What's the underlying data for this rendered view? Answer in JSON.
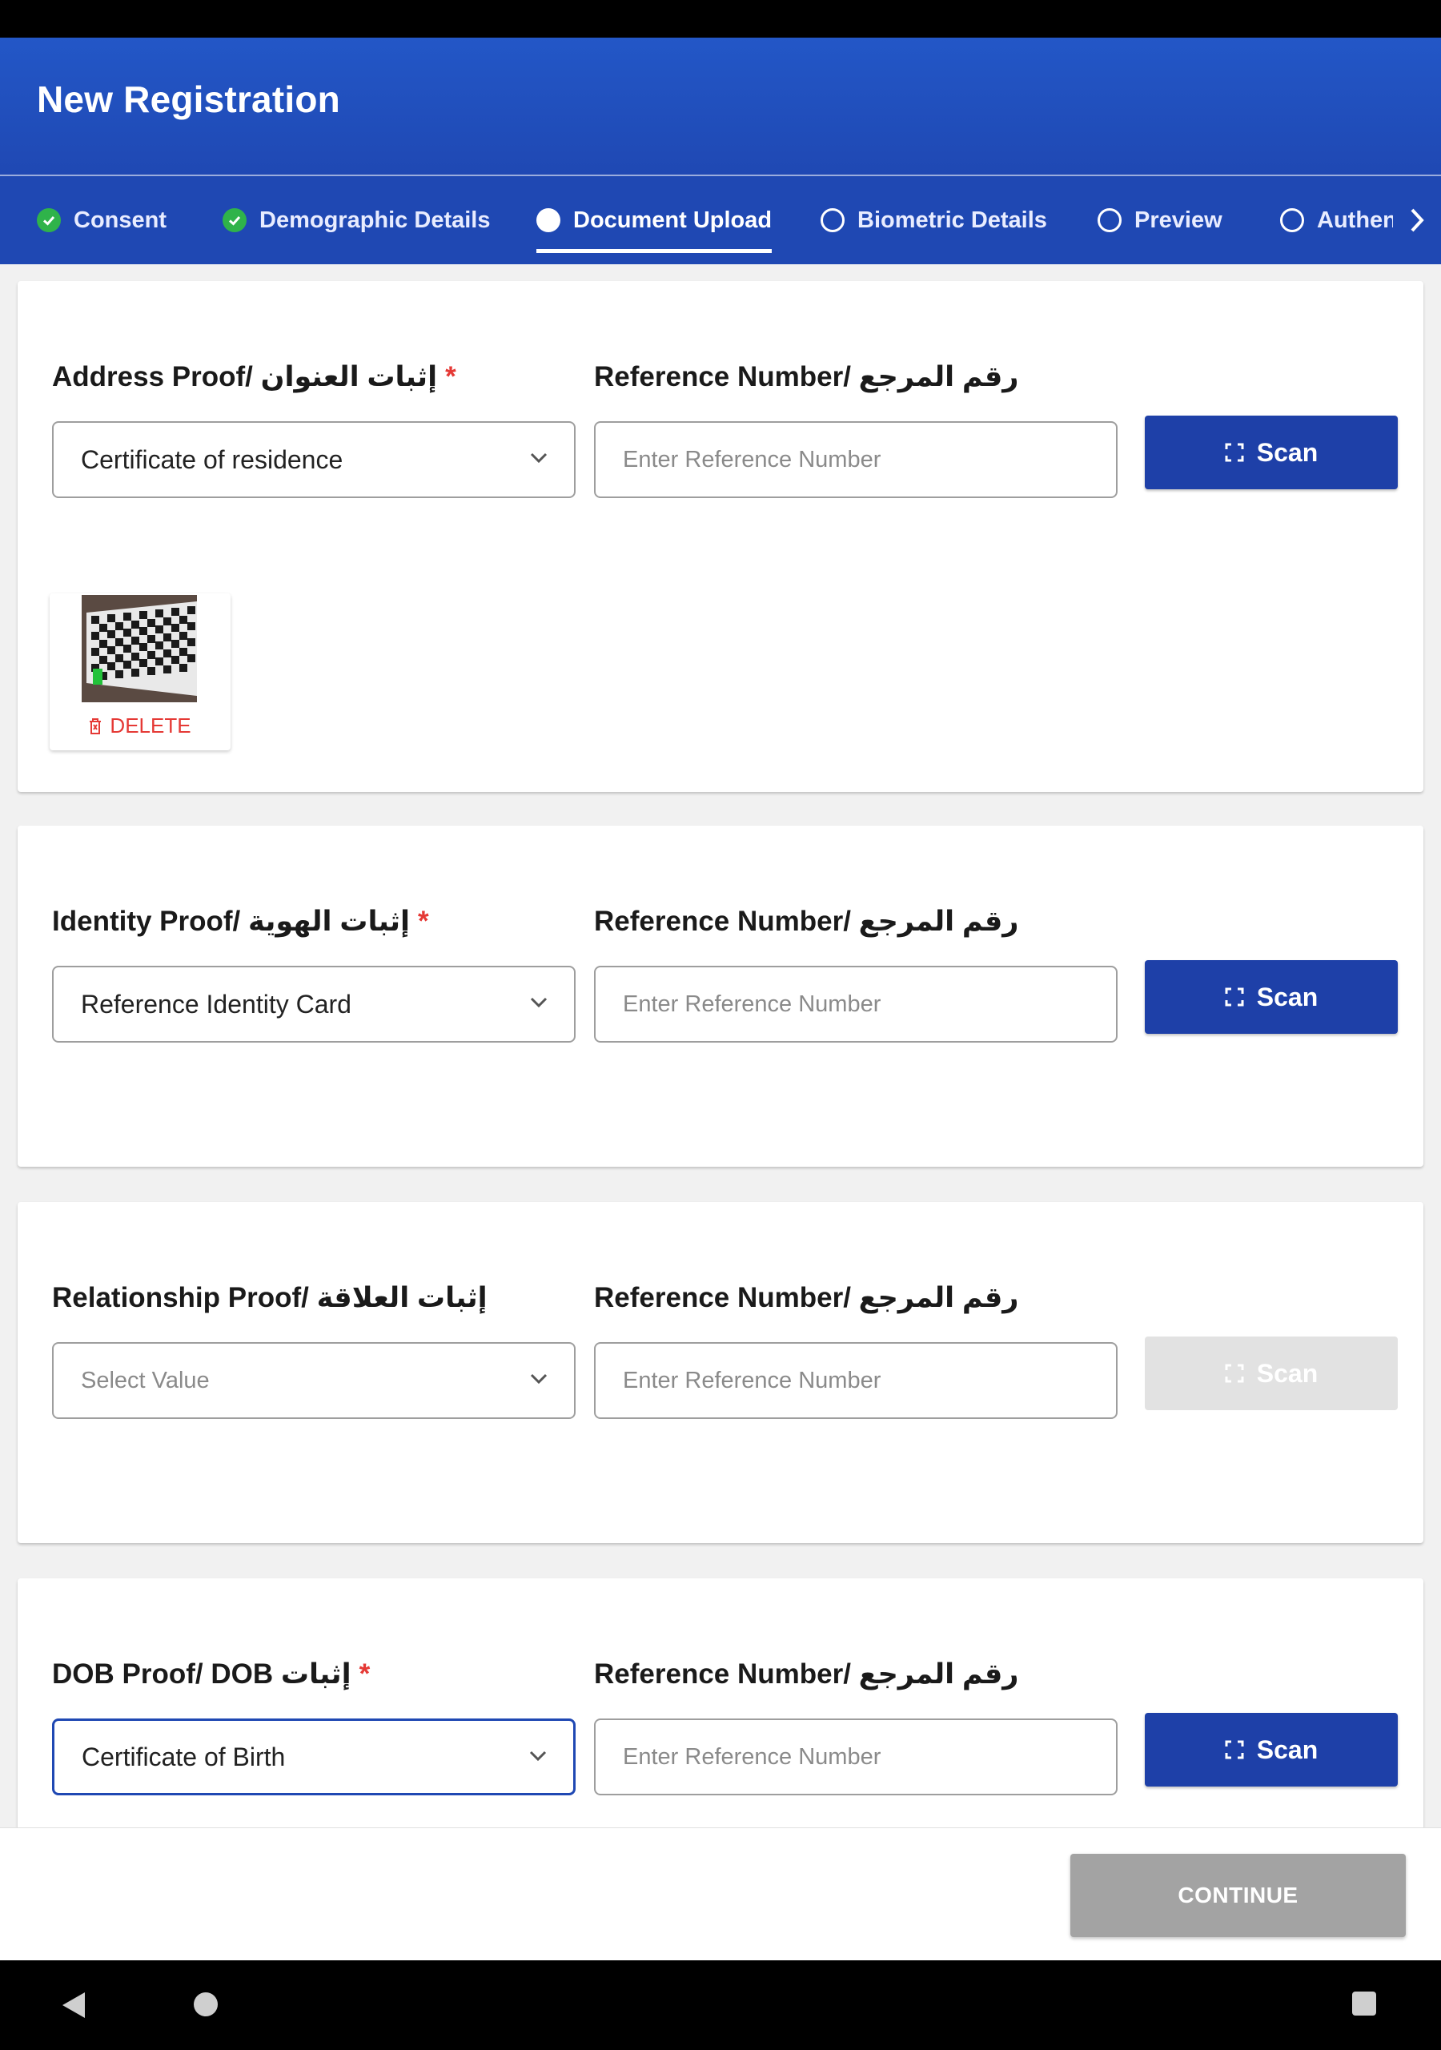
{
  "app": {
    "title": "New Registration"
  },
  "tabs": [
    {
      "label": "Consent",
      "state": "done"
    },
    {
      "label": "Demographic Details",
      "state": "done"
    },
    {
      "label": "Document Upload",
      "state": "active"
    },
    {
      "label": "Biometric Details",
      "state": "pending"
    },
    {
      "label": "Preview",
      "state": "pending"
    },
    {
      "label": "Authent",
      "state": "pending"
    }
  ],
  "cards": [
    {
      "label": "Address Proof/ إثبات العنوان",
      "required": "*",
      "select_value": "Certificate of residence",
      "ref_label": "Reference Number/ رقم المرجع",
      "ref_placeholder": "Enter Reference Number",
      "scan_label": "Scan",
      "delete_label": "DELETE"
    },
    {
      "label": "Identity Proof/ إثبات الهوية",
      "required": "*",
      "select_value": "Reference Identity Card",
      "ref_label": "Reference Number/ رقم المرجع",
      "ref_placeholder": "Enter Reference Number",
      "scan_label": "Scan"
    },
    {
      "label": "Relationship Proof/ إثبات العلاقة",
      "select_placeholder": "Select Value",
      "ref_label": "Reference Number/ رقم المرجع",
      "ref_placeholder": "Enter Reference Number",
      "scan_label": "Scan"
    },
    {
      "label": "DOB Proof/ DOB إثبات",
      "required": "*",
      "select_value": "Certificate of Birth",
      "ref_label": "Reference Number/ رقم المرجع",
      "ref_placeholder": "Enter Reference Number",
      "scan_label": "Scan"
    }
  ],
  "footer": {
    "continue_label": "CONTINUE"
  },
  "colors": {
    "primary": "#1f48b3",
    "scan": "#1e40a8",
    "done": "#2fb34a",
    "required": "#e53935",
    "disabled": "#a3a3a3"
  }
}
